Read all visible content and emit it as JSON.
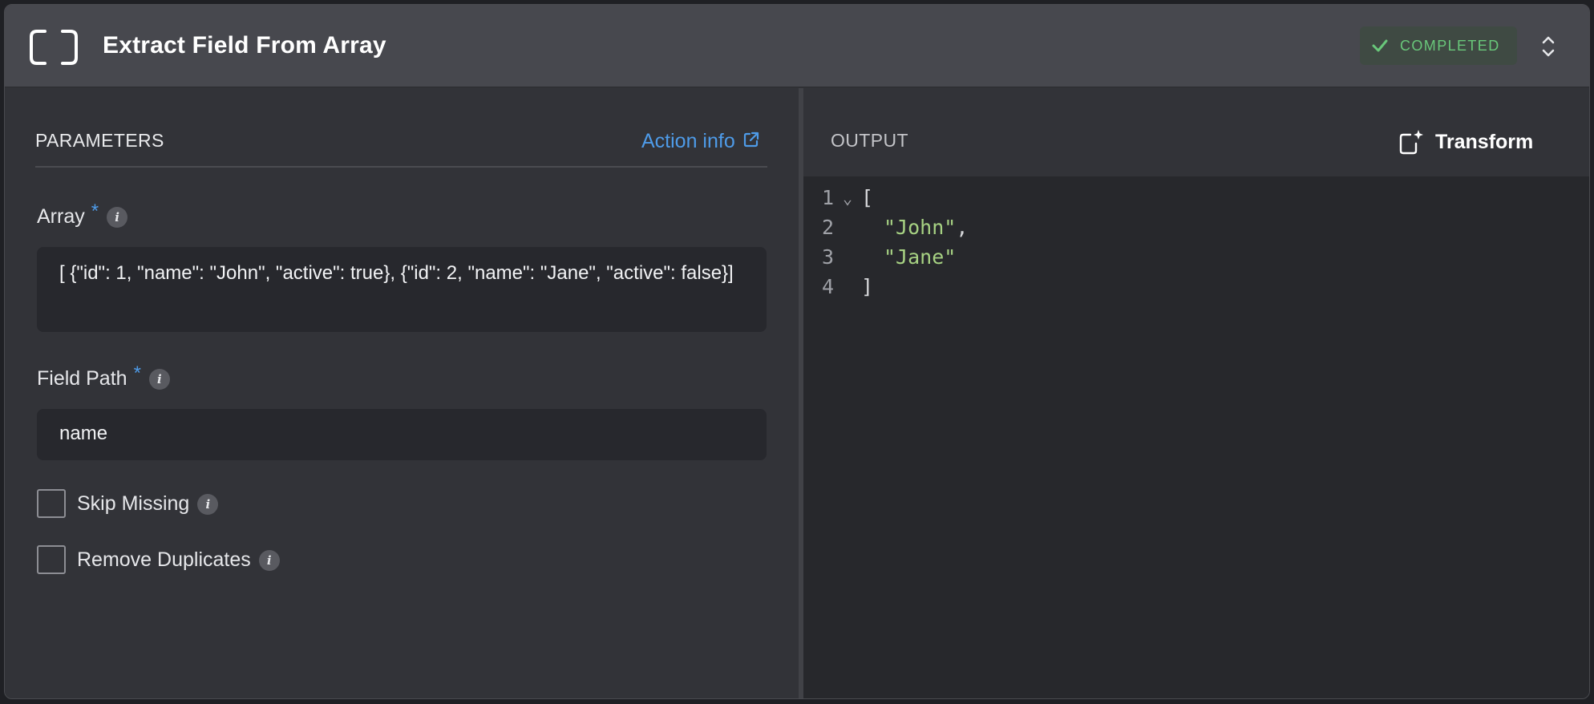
{
  "header": {
    "title": "Extract Field From Array",
    "status": "COMPLETED",
    "icons": {
      "node": "bracket-icon",
      "status": "check-icon",
      "expand": "expand-collapse-icon"
    }
  },
  "parameters": {
    "title": "PARAMETERS",
    "action_info": "Action info",
    "array": {
      "label": "Array",
      "required": "*",
      "info": "i",
      "value": "[ {\"id\": 1, \"name\": \"John\", \"active\": true}, {\"id\": 2, \"name\": \"Jane\", \"active\": false}]"
    },
    "field_path": {
      "label": "Field Path",
      "required": "*",
      "info": "i",
      "value": "name"
    },
    "skip_missing": {
      "label": "Skip Missing",
      "info": "i",
      "checked": false
    },
    "remove_duplicates": {
      "label": "Remove Duplicates",
      "info": "i",
      "checked": false
    }
  },
  "output": {
    "title": "OUTPUT",
    "transform_label": "Transform",
    "lines": [
      {
        "n": "1",
        "fold": "⌄",
        "text": "["
      },
      {
        "n": "2",
        "fold": "",
        "text": "\"John\"",
        "suffix": ","
      },
      {
        "n": "3",
        "fold": "",
        "text": "\"Jane\"",
        "suffix": ""
      },
      {
        "n": "4",
        "fold": "",
        "text": "]"
      }
    ]
  },
  "colors": {
    "accent": "#4e9be8",
    "success": "#69c77a",
    "string": "#a7d283",
    "header_bg": "#47484e",
    "panel_bg": "#323338",
    "code_bg": "#27282c"
  }
}
